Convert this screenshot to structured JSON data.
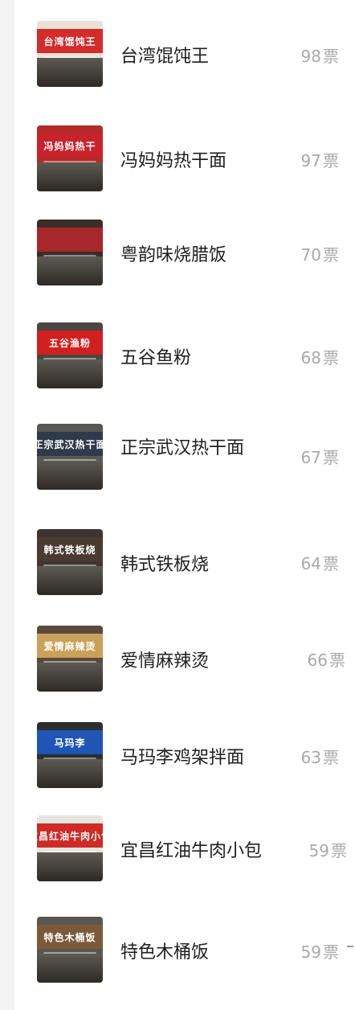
{
  "vote_unit": "票",
  "items": [
    {
      "name": "台湾馄饨王",
      "votes": "98",
      "sign_text": "台湾馄饨王",
      "sign_color": "#d42b2b",
      "thumb_bg": "#e9e3d6"
    },
    {
      "name": "冯妈妈热干面",
      "votes": "97",
      "sign_text": "冯妈妈热干",
      "sign_color": "#c8232c",
      "thumb_bg": "#b52a2a"
    },
    {
      "name": "粤韵味烧腊饭",
      "votes": "70",
      "sign_text": "",
      "sign_color": "#a8272a",
      "thumb_bg": "#3b2d27"
    },
    {
      "name": "五谷鱼粉",
      "votes": "68",
      "sign_text": "五谷渔粉",
      "sign_color": "#d0201f",
      "thumb_bg": "#4a4640"
    },
    {
      "name": "正宗武汉热干面",
      "votes": "67",
      "sign_text": "正宗武汉热干面",
      "sign_color": "#2f3a4a",
      "thumb_bg": "#5a5852"
    },
    {
      "name": "韩式铁板烧",
      "votes": "64",
      "sign_text": "韩式铁板烧",
      "sign_color": "#4a3a30",
      "thumb_bg": "#3e3430"
    },
    {
      "name": "爱情麻辣烫",
      "votes": "66",
      "sign_text": "爱情麻辣烫",
      "sign_color": "#c9a15a",
      "thumb_bg": "#5b4a3c"
    },
    {
      "name": "马玛李鸡架拌面",
      "votes": "63",
      "sign_text": "马玛李",
      "sign_color": "#1f55b5",
      "thumb_bg": "#2d2d2d"
    },
    {
      "name": "宜昌红油牛肉小包",
      "votes": "59",
      "sign_text": "宜昌红油牛肉小包",
      "sign_color": "#cf2a25",
      "thumb_bg": "#e8e4de"
    },
    {
      "name": "特色木桶饭",
      "votes": "59",
      "sign_text": "特色木桶饭",
      "sign_color": "#7b5a3a",
      "thumb_bg": "#5a5650"
    }
  ]
}
